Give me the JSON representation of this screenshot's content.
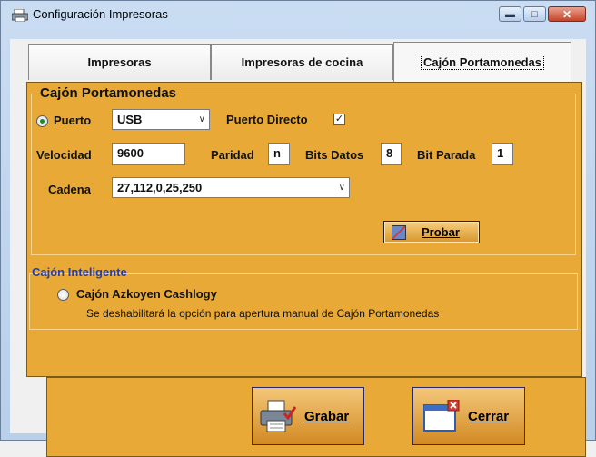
{
  "window": {
    "title": "Configuración Impresoras"
  },
  "tabs": [
    {
      "label": "Impresoras"
    },
    {
      "label": "Impresoras de cocina"
    },
    {
      "label": "Cajón Portamonedas"
    }
  ],
  "cajon_group": {
    "legend": "Cajón Portamonedas",
    "puerto_label": "Puerto",
    "puerto_value": "USB",
    "puerto_directo_label": "Puerto Directo",
    "puerto_directo_checked": true,
    "velocidad_label": "Velocidad",
    "velocidad_value": "9600",
    "paridad_label": "Paridad",
    "paridad_value": "n",
    "bits_datos_label": "Bits Datos",
    "bits_datos_value": "8",
    "bit_parada_label": "Bit Parada",
    "bit_parada_value": "1",
    "cadena_label": "Cadena",
    "cadena_value": "27,112,0,25,250",
    "probar_label": "Probar"
  },
  "inteligente": {
    "legend": "Cajón Inteligente",
    "option_label": "Cajón Azkoyen Cashlogy",
    "note": "Se deshabilitará la opción para apertura manual de Cajón Portamonedas"
  },
  "buttons": {
    "grabar": "Grabar",
    "cerrar": "Cerrar"
  },
  "colors": {
    "panel": "#e8a936",
    "accent": "#1d3fbe"
  }
}
